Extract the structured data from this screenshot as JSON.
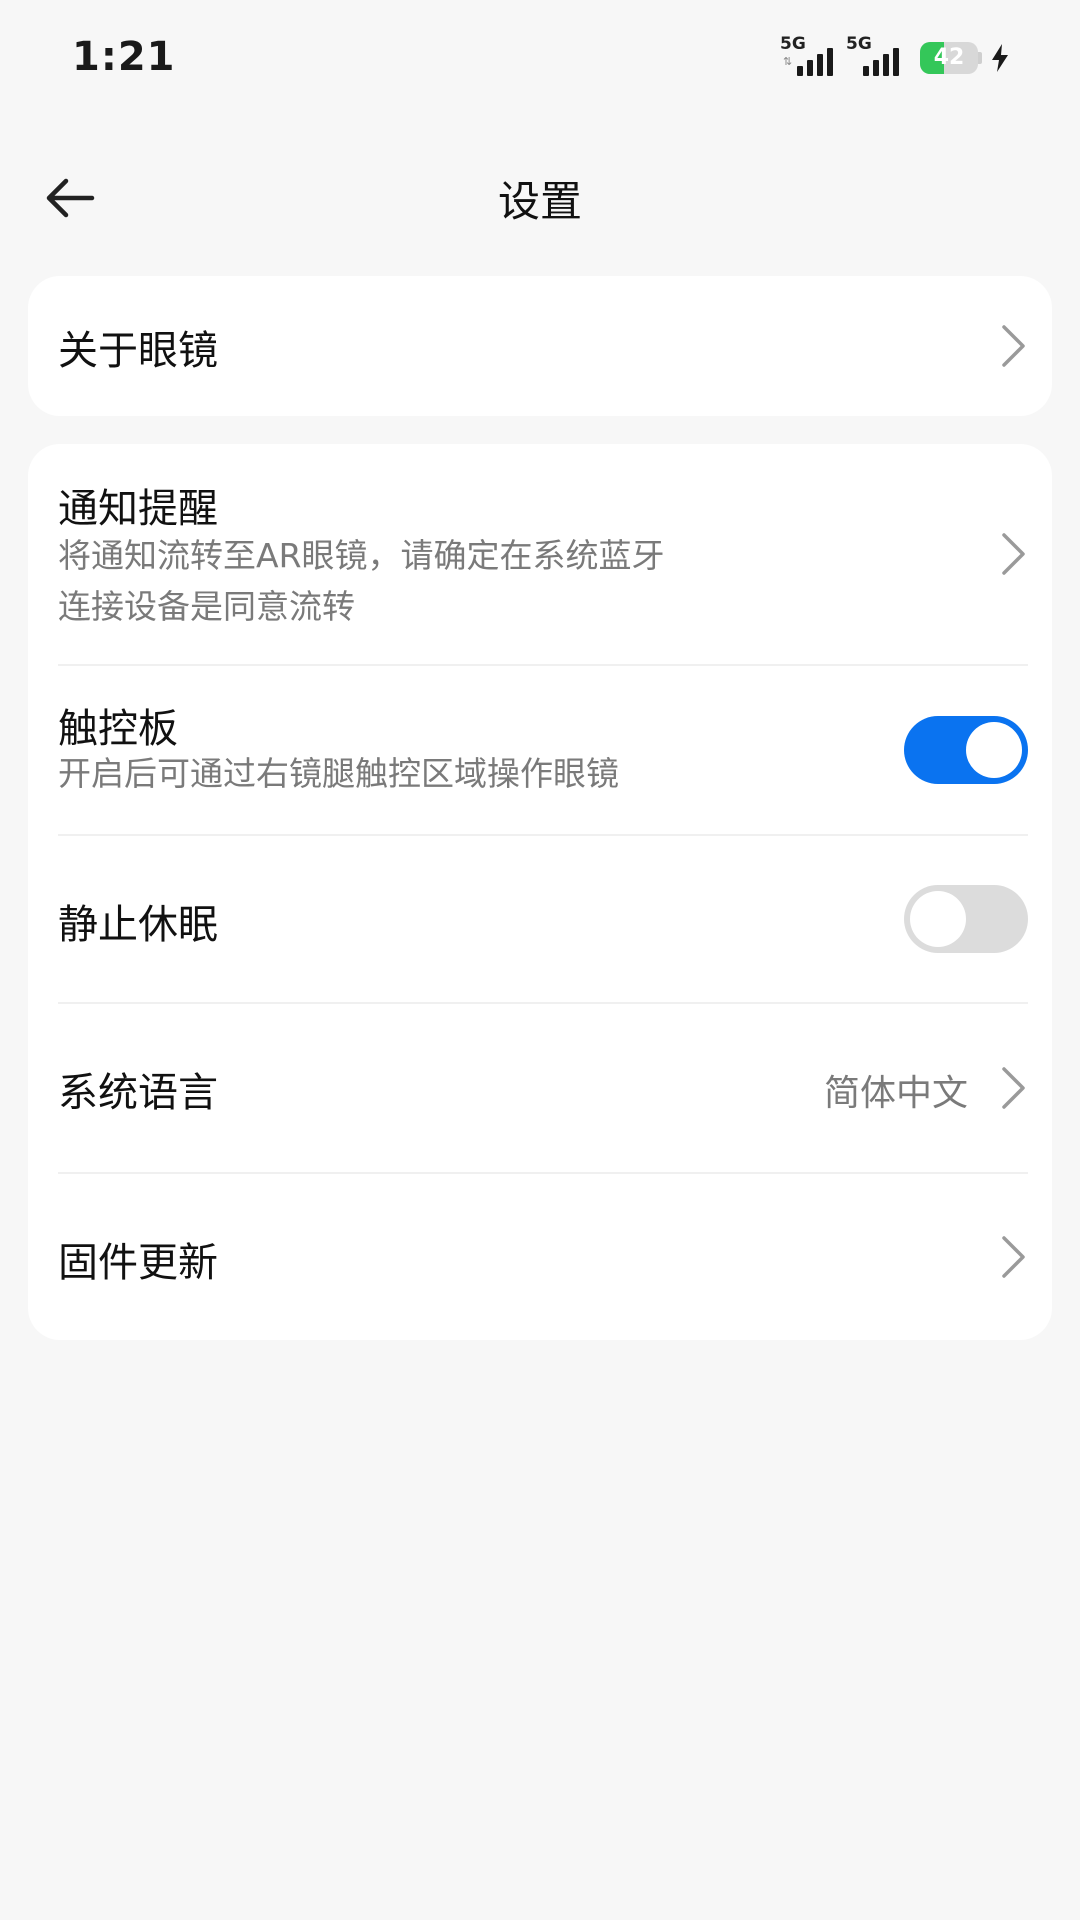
{
  "status_bar": {
    "time": "1:21",
    "network_1": "5G",
    "network_2": "5G",
    "battery_level": "42",
    "battery_fraction": 0.42,
    "battery_color": "#34c759",
    "charging_icon": "lightning-bolt-icon"
  },
  "header": {
    "title": "设置",
    "back_icon": "arrow-left-icon"
  },
  "settings": {
    "about": {
      "label": "关于眼镜"
    },
    "notifications": {
      "label": "通知提醒",
      "description_line1": "将通知流转至AR眼镜，请确定在系统蓝牙",
      "description_line2": "连接设备是同意流转"
    },
    "touchpad": {
      "label": "触控板",
      "description": "开启后可通过右镜腿触控区域操作眼镜",
      "enabled": true
    },
    "no_sleep": {
      "label": "静止休眠",
      "enabled": false
    },
    "language": {
      "label": "系统语言",
      "value": "简体中文"
    },
    "firmware": {
      "label": "固件更新"
    }
  },
  "colors": {
    "accent": "#0a73f0",
    "background": "#f7f7f7",
    "toggle_off": "#dcdcdc"
  }
}
